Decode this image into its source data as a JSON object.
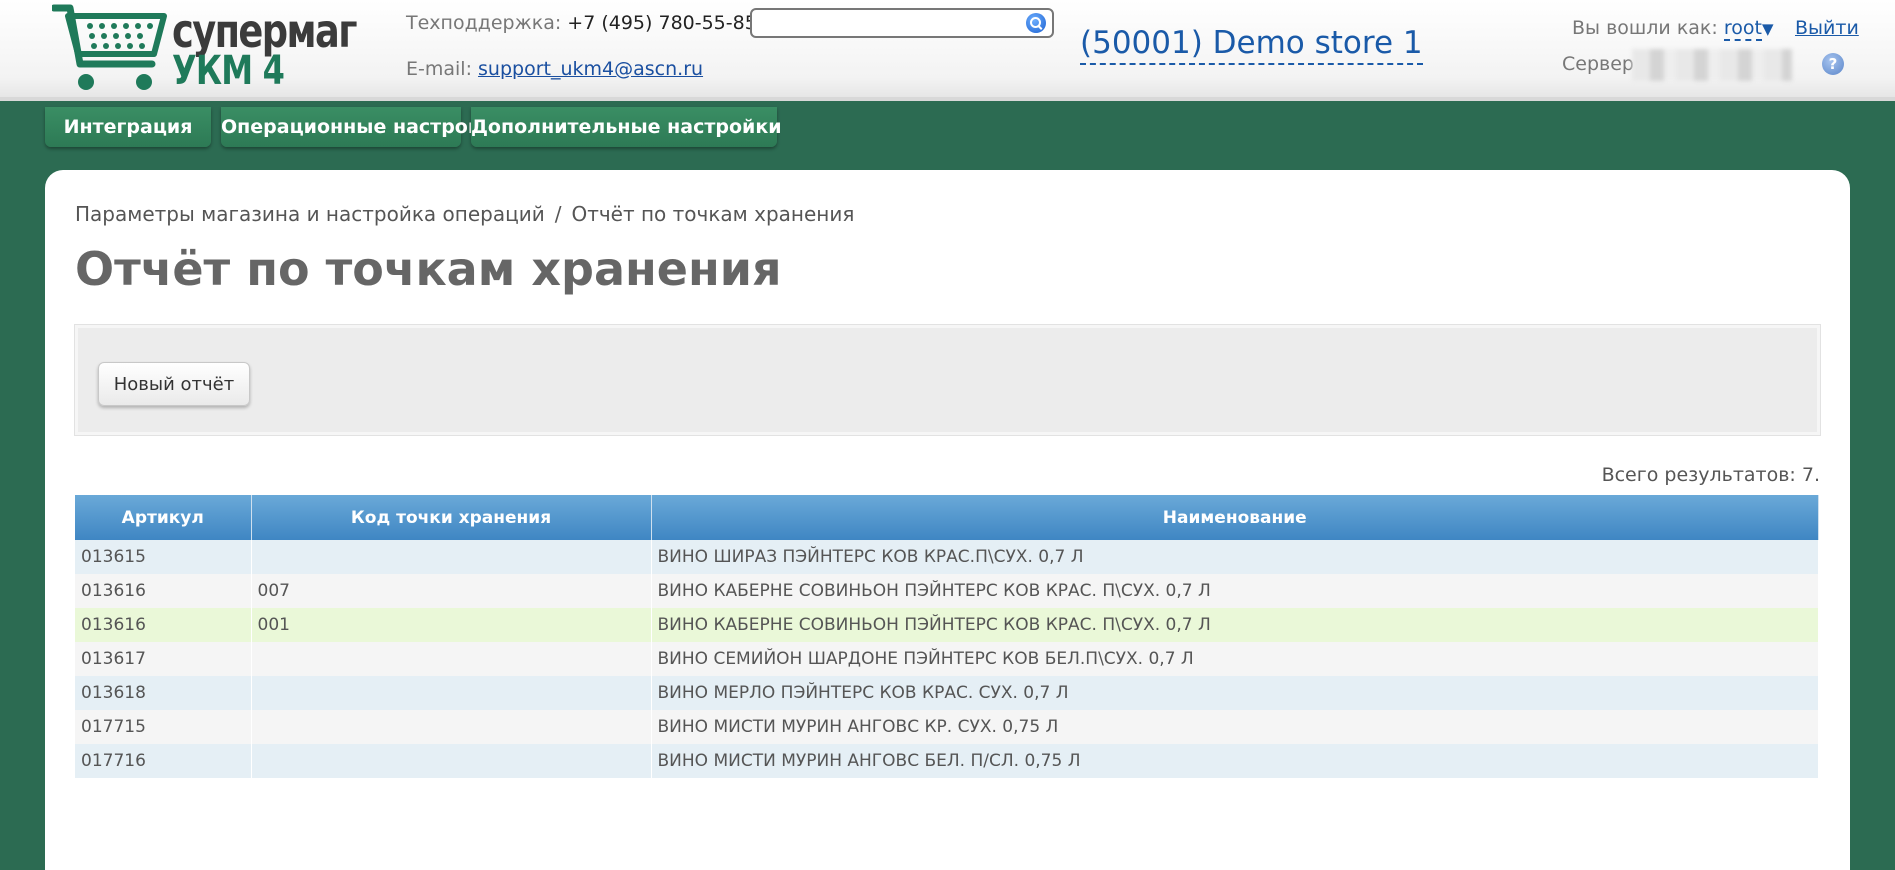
{
  "header": {
    "logo_line1": "супермаг",
    "logo_line2": "УКМ 4",
    "support_label": "Техподдержка:",
    "support_phone": "+7 (495) 780-55-85",
    "email_label": "E-mail:",
    "email": "support_ukm4@ascn.ru",
    "search": {
      "value": "",
      "placeholder": "",
      "icon": "search-icon"
    },
    "store": "(50001) Demo store 1",
    "logged_in_label": "Вы вошли как:",
    "user": "root",
    "user_caret": "▼",
    "logout": "Выйти",
    "server_label": "Сервер:",
    "help": "?"
  },
  "menu": {
    "items": [
      {
        "label": "Интеграция"
      },
      {
        "label": "Операционные настройки"
      },
      {
        "label": "Дополнительные настройки"
      }
    ]
  },
  "main": {
    "breadcrumb": {
      "parent": "Параметры магазина и настройка операций",
      "separator": "/",
      "current": "Отчёт по точкам хранения"
    },
    "title": "Отчёт по точкам хранения",
    "new_report_button": "Новый отчёт",
    "total": "Всего результатов: 7.",
    "table": {
      "columns": [
        "Артикул",
        "Код точки хранения",
        "Наименование"
      ],
      "rows": [
        {
          "article": "013615",
          "code": "",
          "name": "ВИНО ШИРАЗ ПЭЙНТЕРС КОВ КРАС.П\\СУХ. 0,7 Л"
        },
        {
          "article": "013616",
          "code": "007",
          "name": "ВИНО КАБЕРНЕ СОВИНЬОН ПЭЙНТЕРС КОВ КРАС. П\\СУХ. 0,7 Л"
        },
        {
          "article": "013616",
          "code": "001",
          "name": "ВИНО КАБЕРНЕ СОВИНЬОН ПЭЙНТЕРС КОВ КРАС. П\\СУХ. 0,7 Л"
        },
        {
          "article": "013617",
          "code": "",
          "name": "ВИНО СЕМИЙОН ШАРДОНЕ ПЭЙНТЕРС КОВ БЕЛ.П\\СУХ. 0,7 Л"
        },
        {
          "article": "013618",
          "code": "",
          "name": "ВИНО МЕРЛО ПЭЙНТЕРС КОВ КРАС. СУХ. 0,7 Л"
        },
        {
          "article": "017715",
          "code": "",
          "name": "ВИНО МИСТИ МУРИН АНГОВС КР. СУХ. 0,75 Л"
        },
        {
          "article": "017716",
          "code": "",
          "name": "ВИНО МИСТИ МУРИН АНГОВС БЕЛ. П/СЛ. 0,75 Л"
        }
      ]
    }
  },
  "colors": {
    "background": "#2c6b52",
    "menu": "#2d7a55",
    "table_header": "#4a8fc8",
    "link": "#1a5aa8",
    "row_highlight": "#eaf8d8"
  }
}
